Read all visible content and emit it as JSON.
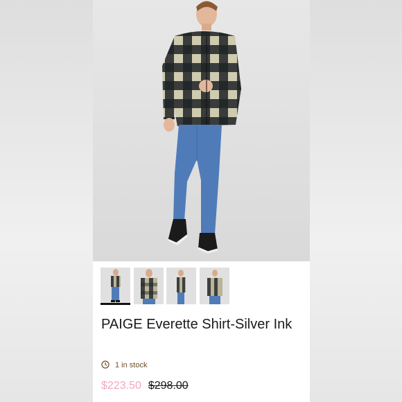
{
  "product": {
    "title": "PAIGE Everette Shirt-Silver Ink",
    "stock": "1 in stock",
    "sale_price": "$223.50",
    "original_price": "$298.00"
  },
  "gallery": {
    "thumbnails": [
      "front-view",
      "front-close-view",
      "side-view",
      "front-view-2"
    ],
    "active_index": 0
  },
  "colors": {
    "sale": "#f2a6c0",
    "stock_icon": "#6b4e2a",
    "shirt_light": "#cfcbb0",
    "shirt_dark": "#1e2326",
    "jeans": "#4f7cb8"
  },
  "icons": {
    "stock": "clock-icon"
  }
}
